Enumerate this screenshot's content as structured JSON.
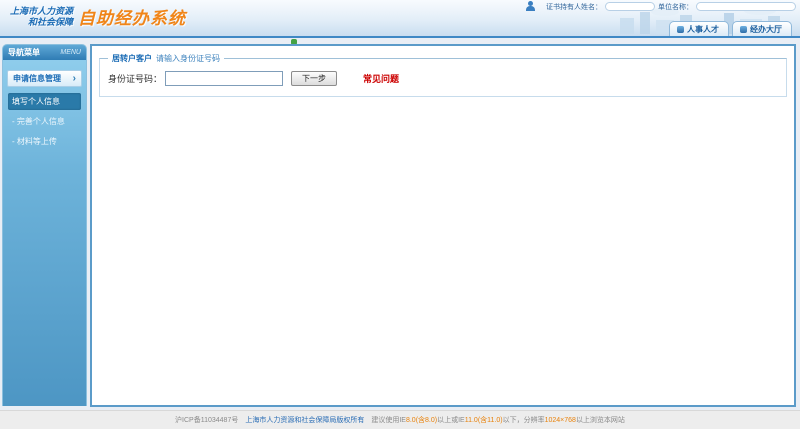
{
  "app": {
    "logo_line1": "上海市人力资源",
    "logo_line2": "和社会保障",
    "logo_title": "自助经办系统"
  },
  "userbar": {
    "cert_holder_label": "证书持有人姓名：",
    "cert_holder_value": "",
    "unit_label": "单位名称：",
    "unit_value": ""
  },
  "nav_tabs": [
    {
      "label": "人事人才"
    },
    {
      "label": "经办大厅"
    }
  ],
  "sidebar": {
    "title": "导航菜单",
    "menu_tag": "MENU",
    "group_label": "申请信息管理",
    "group_arrow": "›",
    "items": [
      {
        "label": "填写个人信息"
      },
      {
        "label": "- 完善个人信息"
      },
      {
        "label": "- 材料等上传"
      }
    ]
  },
  "main": {
    "legend_highlight": "居转户客户",
    "legend_text": "请输入身份证号码",
    "id_label": "身份证号码：",
    "id_value": "",
    "next_button_label": "下一步",
    "faq_label": "常见问题"
  },
  "footer": {
    "icp": "沪ICP备11034487号",
    "copyright": "上海市人力资源和社会保障局版权所有",
    "advice_1": "建议使用IE",
    "ver_1": "8.0(含8.0)",
    "advice_2": "以上或IE",
    "ver_2": "11.0(含11.0)",
    "advice_3": "以下，分辨率",
    "resolution": "1024×768",
    "advice_4": "以上浏览本网站"
  },
  "colors": {
    "accent_blue": "#3f88c5",
    "logo_orange": "#f08519",
    "faq_red": "#cc0000",
    "footer_orange": "#e8820c"
  }
}
